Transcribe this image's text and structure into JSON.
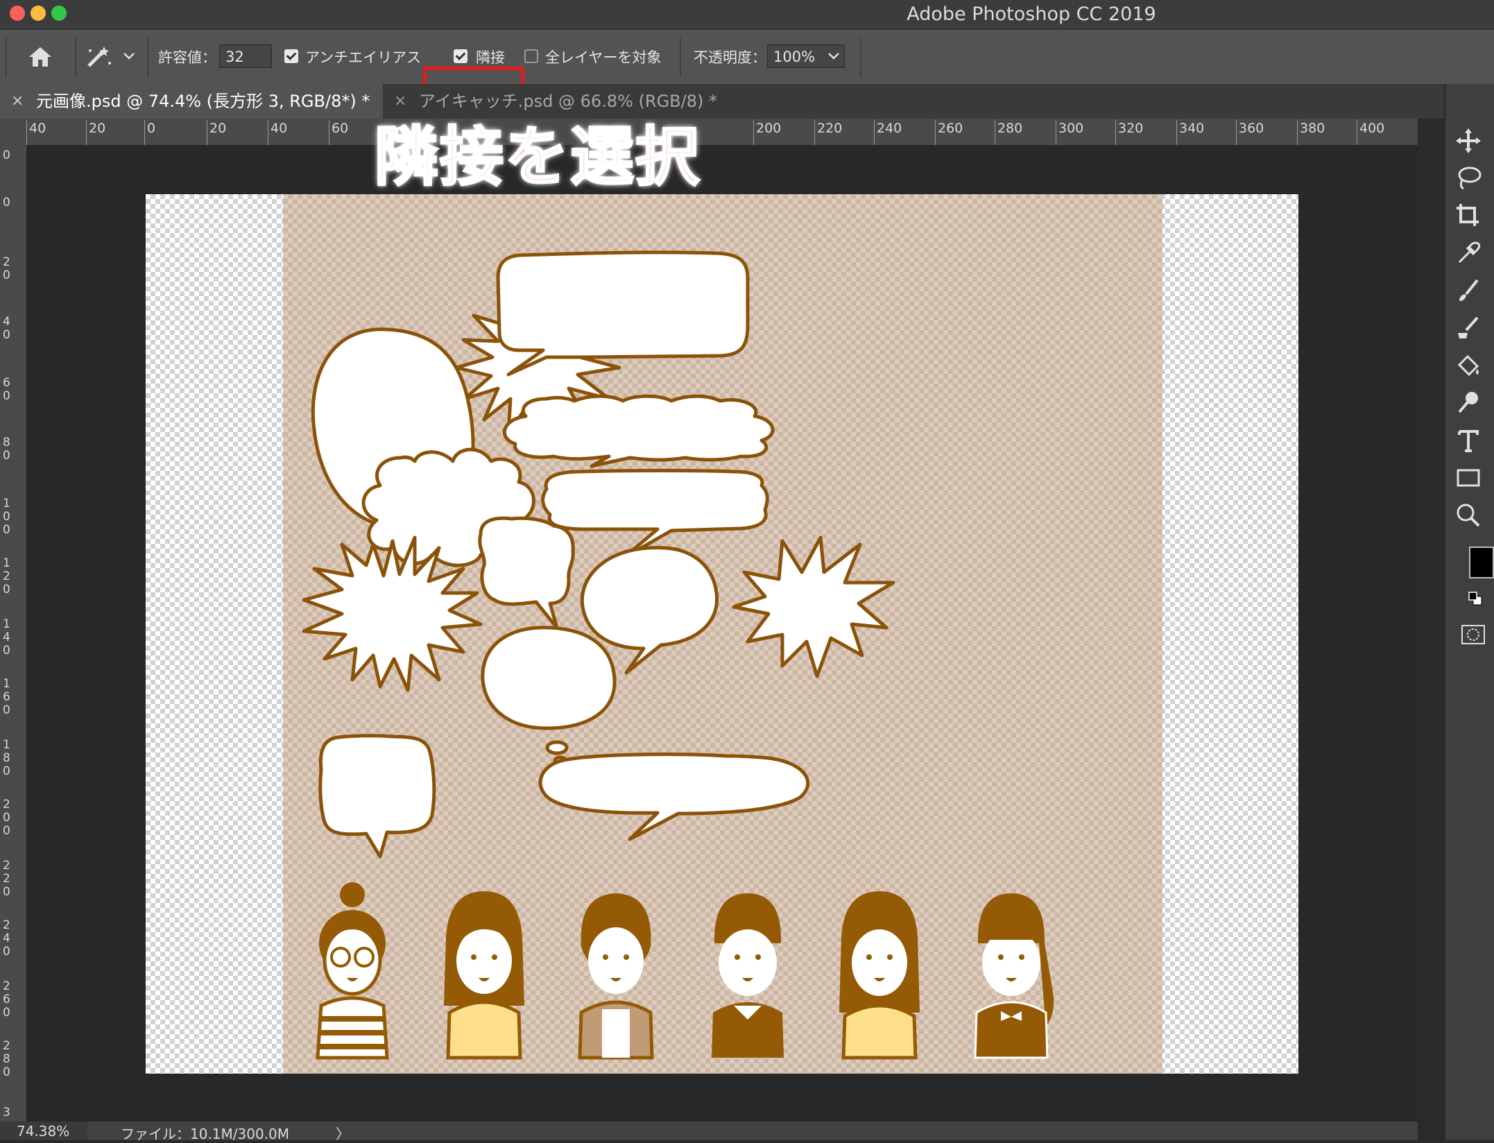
{
  "window": {
    "title": "Adobe Photoshop CC 2019"
  },
  "options": {
    "tolerance_label": "許容値：",
    "tolerance_value": "32",
    "antialias_label": "アンチエイリアス",
    "antialias_checked": true,
    "contiguous_label": "隣接",
    "contiguous_checked": true,
    "all_layers_label": "全レイヤーを対象",
    "all_layers_checked": false,
    "opacity_label": "不透明度：",
    "opacity_value": "100%"
  },
  "tabs": [
    {
      "label": "元画像.psd @ 74.4% (長方形 3, RGB/8*) *",
      "active": true
    },
    {
      "label": "アイキャッチ.psd @ 66.8% (RGB/8) *",
      "active": false
    }
  ],
  "rulers": {
    "horizontal": [
      "40",
      "20",
      "0",
      "20",
      "40",
      "60",
      "200",
      "220",
      "240",
      "260",
      "280",
      "300",
      "320",
      "340",
      "360",
      "380",
      "400"
    ],
    "vertical": [
      "0",
      "0",
      "20",
      "40",
      "60",
      "80",
      "100",
      "120",
      "140",
      "160",
      "180",
      "200",
      "220",
      "240",
      "260",
      "280",
      "3"
    ]
  },
  "annotation": {
    "text": "隣接を選択",
    "color": "#ffc8c8"
  },
  "status": {
    "zoom": "74.38%",
    "file_info": "ファイル：10.1M/300.0M",
    "arrow": "〉"
  },
  "colors": {
    "accent_red": "#e21b1b",
    "outline_brown": "#8b5209",
    "hair_brown": "#955a05",
    "shirt_yellow": "#ffe08a"
  },
  "tools": [
    "move-icon",
    "lasso-icon",
    "crop-icon",
    "eyedropper-icon",
    "brush-icon",
    "clone-stamp-icon",
    "paint-bucket-icon",
    "dodge-icon",
    "type-icon",
    "rectangle-icon",
    "zoom-icon"
  ]
}
